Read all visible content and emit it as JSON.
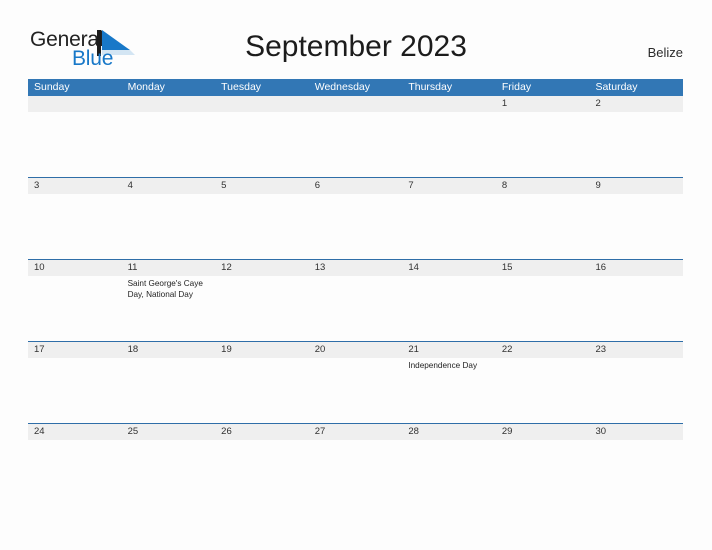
{
  "brand": {
    "name_part1": "General",
    "name_part2": "Blue",
    "logo_icon": "sail-triangle-logo",
    "accent_color": "#1878c8"
  },
  "header": {
    "title": "September 2023",
    "region": "Belize"
  },
  "colors": {
    "header_blue": "#3277b5",
    "row_divider_blue": "#2f6ea8",
    "date_strip_gray": "#efefef",
    "page_background": "#fdfdfd"
  },
  "calendar": {
    "weekdays": [
      "Sunday",
      "Monday",
      "Tuesday",
      "Wednesday",
      "Thursday",
      "Friday",
      "Saturday"
    ],
    "weeks": [
      {
        "days": [
          {
            "date": "",
            "event": ""
          },
          {
            "date": "",
            "event": ""
          },
          {
            "date": "",
            "event": ""
          },
          {
            "date": "",
            "event": ""
          },
          {
            "date": "",
            "event": ""
          },
          {
            "date": "1",
            "event": ""
          },
          {
            "date": "2",
            "event": ""
          }
        ]
      },
      {
        "days": [
          {
            "date": "3",
            "event": ""
          },
          {
            "date": "4",
            "event": ""
          },
          {
            "date": "5",
            "event": ""
          },
          {
            "date": "6",
            "event": ""
          },
          {
            "date": "7",
            "event": ""
          },
          {
            "date": "8",
            "event": ""
          },
          {
            "date": "9",
            "event": ""
          }
        ]
      },
      {
        "days": [
          {
            "date": "10",
            "event": ""
          },
          {
            "date": "11",
            "event": "Saint George's Caye Day, National Day"
          },
          {
            "date": "12",
            "event": ""
          },
          {
            "date": "13",
            "event": ""
          },
          {
            "date": "14",
            "event": ""
          },
          {
            "date": "15",
            "event": ""
          },
          {
            "date": "16",
            "event": ""
          }
        ]
      },
      {
        "days": [
          {
            "date": "17",
            "event": ""
          },
          {
            "date": "18",
            "event": ""
          },
          {
            "date": "19",
            "event": ""
          },
          {
            "date": "20",
            "event": ""
          },
          {
            "date": "21",
            "event": "Independence Day"
          },
          {
            "date": "22",
            "event": ""
          },
          {
            "date": "23",
            "event": ""
          }
        ]
      },
      {
        "days": [
          {
            "date": "24",
            "event": ""
          },
          {
            "date": "25",
            "event": ""
          },
          {
            "date": "26",
            "event": ""
          },
          {
            "date": "27",
            "event": ""
          },
          {
            "date": "28",
            "event": ""
          },
          {
            "date": "29",
            "event": ""
          },
          {
            "date": "30",
            "event": ""
          }
        ]
      }
    ]
  }
}
